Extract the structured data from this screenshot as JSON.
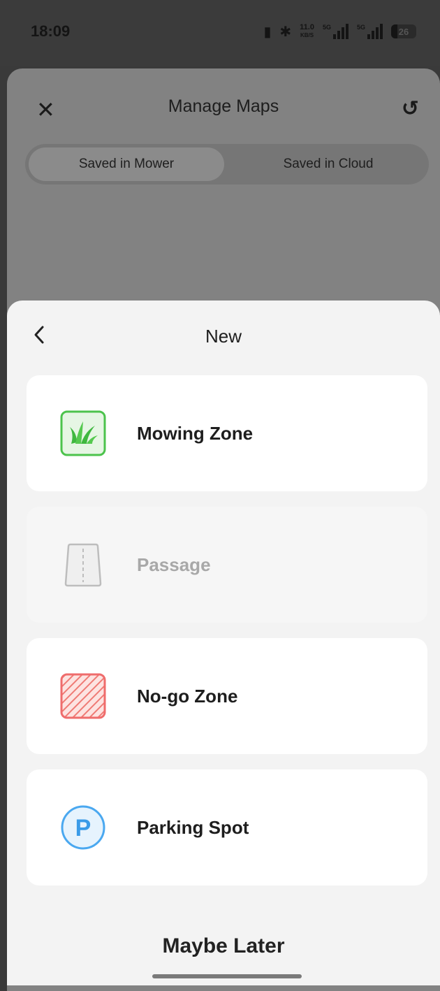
{
  "status_bar": {
    "time": "18:09",
    "speed_value": "11.0",
    "speed_unit": "KB/S",
    "sim1_label": "5G",
    "sim2_label": "5G",
    "battery": "26"
  },
  "background": {
    "title": "Manage Maps",
    "tabs": [
      "Saved in Mower",
      "Saved in Cloud"
    ],
    "active_tab": "Saved in Mower"
  },
  "sheet": {
    "title": "New",
    "options": [
      {
        "label": "Mowing Zone",
        "icon": "grass-icon",
        "enabled": true,
        "color": "#4cc34c"
      },
      {
        "label": "Passage",
        "icon": "passage-icon",
        "enabled": false,
        "color": "#bdbdbd"
      },
      {
        "label": "No-go Zone",
        "icon": "no-go-zone-icon",
        "enabled": true,
        "color": "#ef6c6c"
      },
      {
        "label": "Parking Spot",
        "icon": "parking-icon",
        "enabled": true,
        "color": "#4aa8f0"
      }
    ],
    "dismiss_label": "Maybe Later"
  }
}
